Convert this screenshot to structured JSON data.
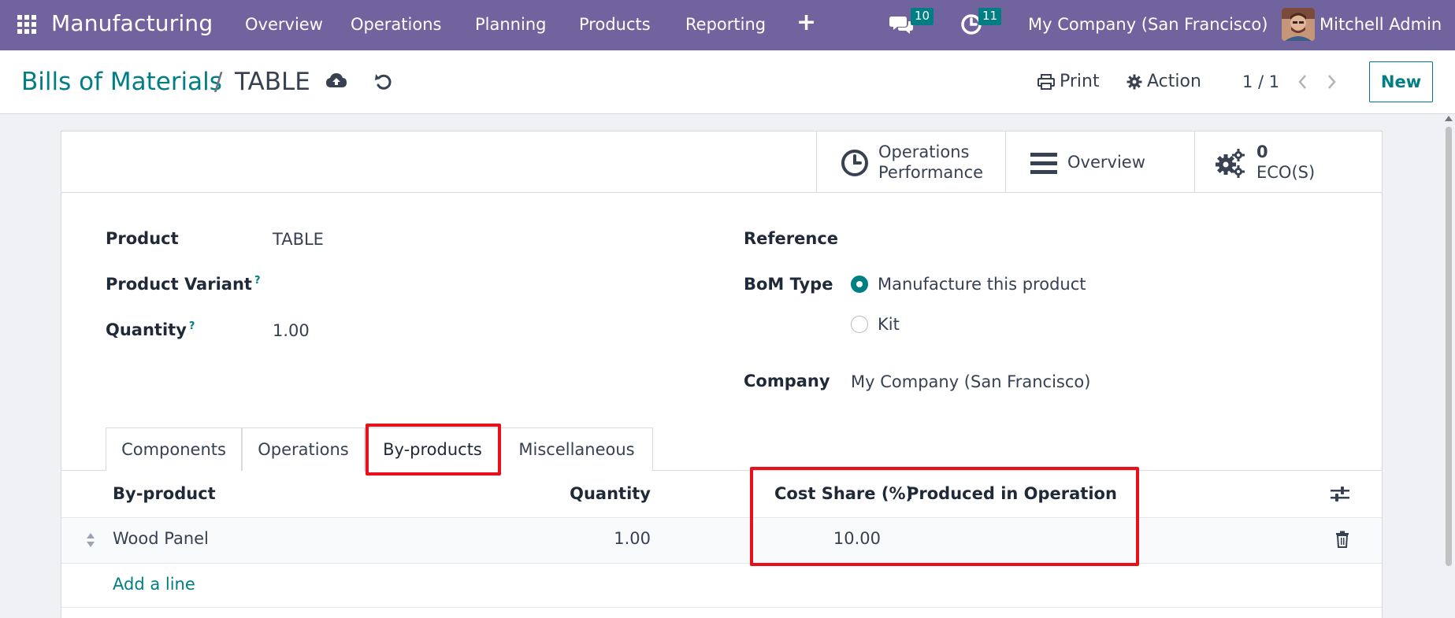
{
  "navbar": {
    "apps_icon": "grid-icon",
    "brand": "Manufacturing",
    "menu": [
      "Overview",
      "Operations",
      "Planning",
      "Products",
      "Reporting"
    ],
    "plus": "+",
    "messages_badge": "10",
    "activities_badge": "11",
    "company": "My Company (San Francisco)",
    "user": "Mitchell Admin",
    "color": "#71639e"
  },
  "control_panel": {
    "breadcrumb_parent": "Bills of Materials",
    "breadcrumb_separator": "/",
    "breadcrumb_current": "TABLE",
    "print_label": "Print",
    "action_label": "Action",
    "pager": "1 / 1",
    "new_label": "New"
  },
  "smart_buttons": {
    "operations_performance": [
      "Operations",
      "Performance"
    ],
    "overview": "Overview",
    "eco_count": "0",
    "eco_label": "ECO(S)"
  },
  "form": {
    "product_label": "Product",
    "product_value": "TABLE",
    "variant_label": "Product Variant",
    "quantity_label": "Quantity",
    "quantity_value": "1.00",
    "help_mark": "?",
    "reference_label": "Reference",
    "bom_type_label": "BoM Type",
    "bom_type_options": [
      "Manufacture this product",
      "Kit"
    ],
    "bom_type_selected": "Manufacture this product",
    "company_label": "Company",
    "company_value": "My Company (San Francisco)"
  },
  "tabs": [
    "Components",
    "Operations",
    "By-products",
    "Miscellaneous"
  ],
  "active_tab": "By-products",
  "byproducts_table": {
    "columns": [
      "By-product",
      "Quantity",
      "Cost Share (%)",
      "Produced in Operation"
    ],
    "rows": [
      {
        "byproduct": "Wood Panel",
        "quantity": "1.00",
        "cost_share": "10.00",
        "operation": ""
      }
    ],
    "add_line": "Add a line"
  },
  "colors": {
    "accent": "#017e84",
    "highlight": "#e8111b"
  }
}
